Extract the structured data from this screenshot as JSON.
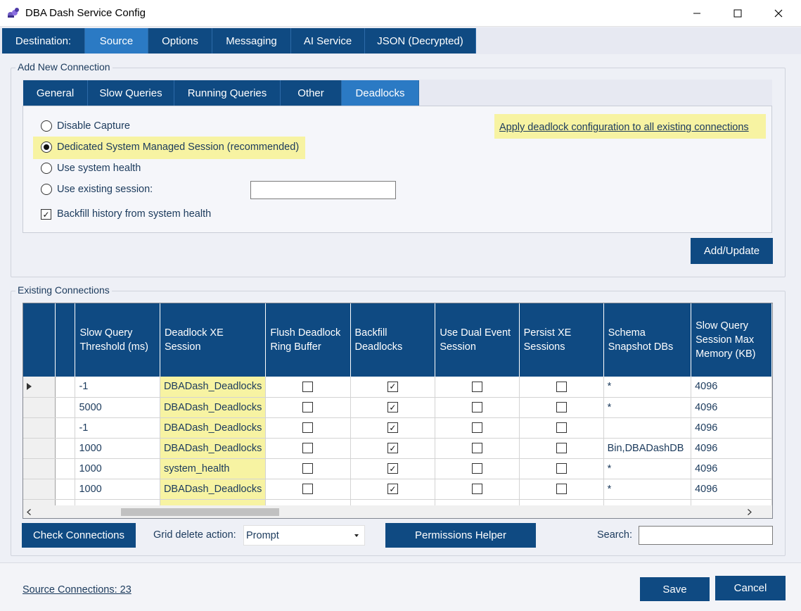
{
  "window": {
    "title": "DBA Dash Service Config",
    "minimize_icon": "minimize-icon",
    "maximize_icon": "maximize-icon",
    "close_icon": "close-icon"
  },
  "main_tabs": [
    "Destination:",
    "Source",
    "Options",
    "Messaging",
    "AI Service",
    "JSON (Decrypted)"
  ],
  "main_tab_active": "Source",
  "add_new_connection": {
    "title": "Add New Connection",
    "tabs": [
      "General",
      "Slow Queries",
      "Running Queries",
      "Other",
      "Deadlocks"
    ],
    "active_tab": "Deadlocks",
    "options": [
      {
        "label": "Disable Capture",
        "checked": false
      },
      {
        "label": "Dedicated System Managed Session (recommended)",
        "checked": true
      },
      {
        "label": "Use system health",
        "checked": false
      },
      {
        "label": "Use existing session:",
        "checked": false
      }
    ],
    "existing_session_value": "",
    "backfill_label": "Backfill history from system health",
    "backfill_checked": true,
    "apply_link": "Apply deadlock configuration to all existing connections",
    "add_update_button": "Add/Update"
  },
  "existing_connections": {
    "title": "Existing Connections",
    "columns": [
      "Slow Query Threshold (ms)",
      "Deadlock XE Session",
      "Flush Deadlock Ring Buffer",
      "Backfill Deadlocks",
      "Use Dual Event Session",
      "Persist XE Sessions",
      "Schema Snapshot DBs",
      "Slow Query Session Max Memory (KB)"
    ],
    "rows": [
      {
        "threshold": "-1",
        "session": "DBADash_Deadlocks",
        "flush": false,
        "backfill": true,
        "dual": false,
        "persist": false,
        "schema": "*",
        "memory": "4096",
        "current": true
      },
      {
        "threshold": "5000",
        "session": "DBADash_Deadlocks",
        "flush": false,
        "backfill": true,
        "dual": false,
        "persist": false,
        "schema": "*",
        "memory": "4096",
        "current": false
      },
      {
        "threshold": "-1",
        "session": "DBADash_Deadlocks",
        "flush": false,
        "backfill": true,
        "dual": false,
        "persist": false,
        "schema": "",
        "memory": "4096",
        "current": false
      },
      {
        "threshold": "1000",
        "session": "DBADash_Deadlocks",
        "flush": false,
        "backfill": true,
        "dual": false,
        "persist": false,
        "schema": "Bin,DBADashDB",
        "memory": "4096",
        "current": false
      },
      {
        "threshold": "1000",
        "session": "system_health",
        "flush": false,
        "backfill": true,
        "dual": false,
        "persist": false,
        "schema": "*",
        "memory": "4096",
        "current": false
      },
      {
        "threshold": "1000",
        "session": "DBADash_Deadlocks",
        "flush": false,
        "backfill": true,
        "dual": false,
        "persist": false,
        "schema": "*",
        "memory": "4096",
        "current": false
      }
    ]
  },
  "bottom_bar": {
    "check_connections": "Check Connections",
    "grid_delete_label": "Grid delete action:",
    "grid_delete_value": "Prompt",
    "permissions_helper": "Permissions Helper",
    "search_label": "Search:",
    "search_value": ""
  },
  "footer": {
    "source_connections": "Source Connections: 23",
    "save": "Save",
    "cancel": "Cancel"
  },
  "colors": {
    "tab_bg": "#0f4a82",
    "tab_active": "#2b7ac4",
    "highlight": "#f7f3a2"
  }
}
